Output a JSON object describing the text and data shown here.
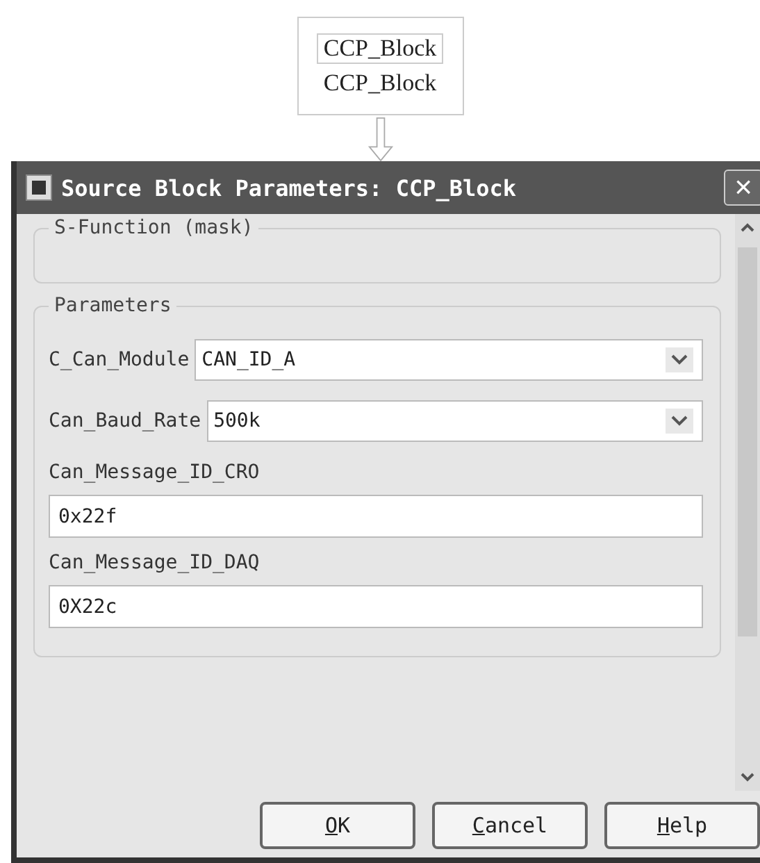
{
  "block": {
    "name": "CCP_Block",
    "caption": "CCP_Block"
  },
  "window": {
    "title": "Source Block Parameters: CCP_Block",
    "close": "×"
  },
  "description_group": {
    "title": "S-Function (mask)"
  },
  "parameters_group": {
    "title": "Parameters"
  },
  "parameters": [
    {
      "kind": "dropdown",
      "label": "C_Can_Module",
      "value": "CAN_ID_A"
    },
    {
      "kind": "dropdown",
      "label": "Can_Baud_Rate",
      "value": "500k"
    },
    {
      "kind": "text",
      "label": "Can_Message_ID_CRO",
      "value": "0x22f"
    },
    {
      "kind": "text",
      "label": "Can_Message_ID_DAQ",
      "value": "0X22c"
    }
  ],
  "buttons": [
    "OK",
    "Cancel",
    "Help"
  ]
}
